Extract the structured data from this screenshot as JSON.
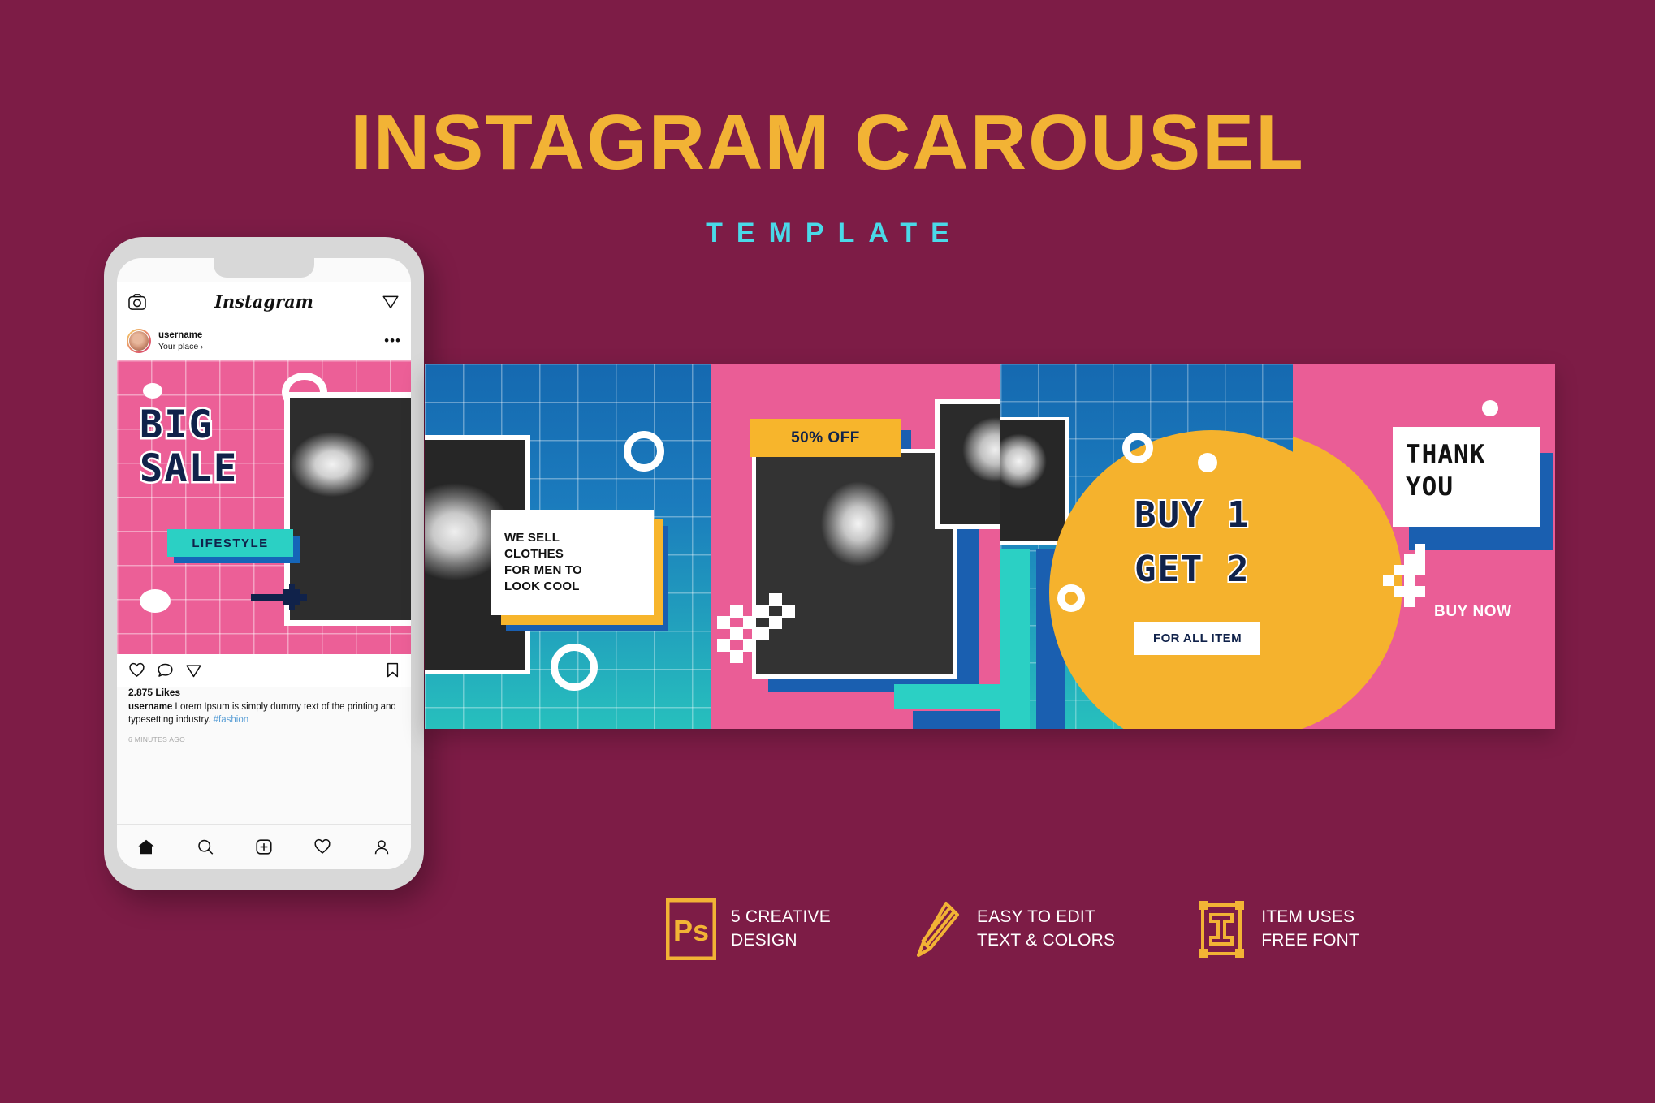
{
  "header": {
    "title": "INSTAGRAM CAROUSEL",
    "subtitle": "TEMPLATE",
    "title_color": "#f2b335",
    "subtitle_color": "#4ad9e8"
  },
  "background_color": "#7d1c46",
  "phone": {
    "app_name": "Instagram",
    "topbar": {
      "camera_icon": "camera-icon",
      "send_icon": "paper-plane-icon"
    },
    "user": {
      "name": "username",
      "place": "Your place",
      "more_icon": "more-options-icon"
    },
    "actions": {
      "like_icon": "heart-icon",
      "comment_icon": "comment-icon",
      "share_icon": "paper-plane-icon",
      "save_icon": "bookmark-icon"
    },
    "likes": "2.875 Likes",
    "caption_user": "username",
    "caption_text": "Lorem Ipsum is simply dummy text of the printing and typesetting industry.",
    "caption_hashtag": "#fashion",
    "time": "6 MINUTES AGO",
    "nav": [
      {
        "name": "home-icon",
        "label": "Home"
      },
      {
        "name": "search-icon",
        "label": "Search"
      },
      {
        "name": "add-post-icon",
        "label": "Add"
      },
      {
        "name": "activity-heart-icon",
        "label": "Activity"
      },
      {
        "name": "profile-icon",
        "label": "Profile"
      }
    ]
  },
  "slides": {
    "slide1": {
      "title_line1": "BIG",
      "title_line2": "SALE",
      "button_label": "LIFESTYLE",
      "bg_color": "#ec5f97",
      "accent_color": "#2bd0c4"
    },
    "slide2": {
      "text": "WE SELL CLOTHES FOR MEN TO LOOK COOL",
      "line1": "WE SELL",
      "line2": "CLOTHES",
      "line3": "FOR MEN TO",
      "line4": "LOOK COOL",
      "bg_gradient_from": "#1569b0",
      "bg_gradient_to": "#27c0bd"
    },
    "slide3": {
      "badge": "50% OFF",
      "bg_color": "#ea5d96",
      "badge_color": "#f7b52c"
    },
    "slide4": {
      "title_line1": "BUY 1",
      "title_line2": "GET 2",
      "button_label": "FOR ALL ITEM",
      "circle_color": "#f5b22d"
    },
    "slide5": {
      "title_line1": "THANK",
      "title_line2": "YOU",
      "cta": "BUY NOW",
      "bg_color": "#ea5d96"
    }
  },
  "features": [
    {
      "icon": "photoshop-icon",
      "line1": "5 CREATIVE",
      "line2": "DESIGN"
    },
    {
      "icon": "pencil-icon",
      "line1": "EASY TO EDIT",
      "line2": "TEXT & COLORS"
    },
    {
      "icon": "free-font-icon",
      "line1": "ITEM USES",
      "line2": "FREE FONT"
    }
  ]
}
